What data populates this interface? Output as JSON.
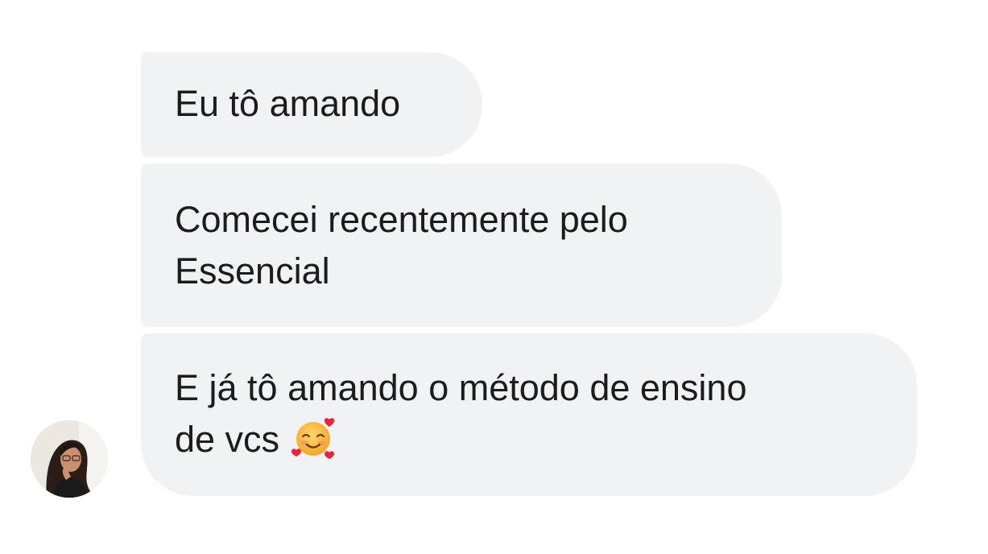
{
  "messages": [
    {
      "lines": [
        "Eu tô amando"
      ]
    },
    {
      "lines": [
        "Comecei recentemente pelo",
        "Essencial"
      ]
    },
    {
      "lines": [
        "E já tô amando o método de ensino",
        "de vcs"
      ],
      "trailing_icon": "smiling-face-with-hearts-icon"
    }
  ],
  "colors": {
    "bubble_bg": "#f1f2f4",
    "text": "#1c1c1e",
    "page_bg": "#ffffff"
  },
  "avatar": {
    "icon": "profile-photo"
  }
}
